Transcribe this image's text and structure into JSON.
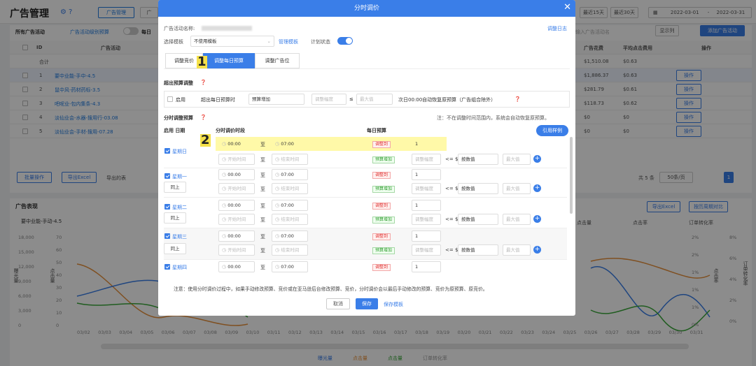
{
  "page": {
    "title": "广告管理",
    "top_tabs": [
      "广告管理",
      "广"
    ],
    "date_shortcuts": [
      "最近15天",
      "最近30天"
    ],
    "date_start": "2022-03-01",
    "date_end": "2022-03-31",
    "filter_label": "所有广告活动",
    "filter_link": "广告活动级别预算",
    "daily_label": "每日",
    "display_col_btn": "显示列",
    "add_campaign_btn": "添加广告活动",
    "search_placeholder": "输入广告活动名",
    "col_id": "ID",
    "col_campaign": "广告活动",
    "col_spend": "广告花费",
    "col_cpc": "平均点击费用",
    "col_action": "操作",
    "total_label": "合计",
    "total_spend": "$1,510.08",
    "total_cpc": "$0.63",
    "rows": [
      {
        "id": "1",
        "name": "要中业能-手中-4.5",
        "spend": "$1,886.37",
        "cpc": "$0.63"
      },
      {
        "id": "2",
        "name": "鼠中风-药材药标-3.5",
        "spend": "$281.79",
        "cpc": "$0.61"
      },
      {
        "id": "3",
        "name": "吧呢业-包内集条-4.3",
        "spend": "$118.73",
        "cpc": "$0.62"
      },
      {
        "id": "4",
        "name": "淡仙业会-水器-搜用行-03.08",
        "spend": "$0",
        "cpc": "$0"
      },
      {
        "id": "5",
        "name": "淡仙业会-手材-搜用-07.28",
        "spend": "$0",
        "cpc": "$0"
      }
    ],
    "action_label": "操作",
    "bulk_btn": "批量操作",
    "export_btn": "导出Excel",
    "export_btn2": "导出的表",
    "pager_total": "共 5 条",
    "pager_size": "50条/页",
    "pager_current": "1",
    "chart_title": "广告表现",
    "chart_subtitle": "要中业能-手动-4.5",
    "chart_export": "导出Excel",
    "chart_compare": "按历周期对比",
    "y_left_label1": "曝光量",
    "y_left_label2": "点击量",
    "y_right_label1": "点击率",
    "y_right_label2": "订单转化率",
    "y_left_ticks": [
      "18,000",
      "15,000",
      "12,000",
      "9,000",
      "6,000",
      "3,000",
      "0"
    ],
    "y_left2_ticks": [
      "70",
      "60",
      "50",
      "40",
      "30",
      "20",
      "10",
      "0"
    ],
    "y_right_ticks": [
      "2%",
      "2%",
      "1%",
      "1%",
      "1%",
      "0%"
    ],
    "y_right2_ticks": [
      "8%",
      "6%",
      "4%",
      "2%",
      "0%"
    ],
    "x_ticks": [
      "03/02",
      "03/03",
      "03/04",
      "03/05",
      "03/06",
      "03/07",
      "03/08",
      "03/09",
      "03/10",
      "03/11",
      "03/12",
      "03/13",
      "03/14",
      "03/15",
      "03/16",
      "03/17",
      "03/18",
      "03/19",
      "03/20",
      "03/21",
      "03/22",
      "03/23",
      "03/24",
      "03/25",
      "03/26",
      "03/27",
      "03/28",
      "03/29",
      "03/30",
      "03/31"
    ],
    "legend": [
      "曝光量",
      "点击量",
      "点击量",
      "订单转化率"
    ],
    "col_clicks": "点击量",
    "col_ctr": "点击率",
    "col_orders": "订单转化率"
  },
  "modal": {
    "title": "分时调价",
    "campaign_name_label": "广告活动名称:",
    "change_log_link": "调整日志",
    "template_label": "选择模板",
    "template_value": "不使用模板",
    "manage_template_link": "管理模板",
    "plan_status_label": "计划状态",
    "tabs": [
      "调整竞价",
      "调整每日预算",
      "调整广告位"
    ],
    "section1_title": "超出预算调整",
    "enable_label": "启用",
    "exceed_label": "超出每日预算时",
    "budget_increase": "预算增加",
    "adjust_amount_placeholder": "调整幅度",
    "lte_symbol": "≤",
    "max_value_placeholder": "最大值",
    "restore_text": "次日00:00自动恢复原预算（广告组合除外）",
    "section2_title": "分时调整预算",
    "note_top": "注：不在调整时间范围内，系统会自动恢复原预算。",
    "col_enable_date": "启用 日期",
    "col_time": "分时调价时段",
    "col_daily_budget": "每日预算",
    "quote_template_btn": "引用样例",
    "to_label": "至",
    "start_time": "00:00",
    "end_time": "07:00",
    "start_placeholder": "开始时间",
    "end_placeholder": "结束时间",
    "tag_adjust_to": "调整到",
    "tag_budget_increase": "预算增加",
    "value_one": "1",
    "adjust_placeholder": "调整幅度",
    "lte5": "<= $",
    "by_value": "按数值",
    "max_placeholder": "最大值",
    "same_as_above": "同上",
    "days": [
      "星期日",
      "星期一",
      "星期二",
      "星期三",
      "星期四"
    ],
    "note_bottom": "注意：使用分时调价过程中，如果手动修改预算、竞价或在亚马逊后台修改预算、竞价，分时调价会以最后手动修改的预算、竞价为原预算、原竞价。",
    "cancel_btn": "取消",
    "save_btn": "保存",
    "save_template_link": "保存模板"
  },
  "annotations": {
    "one": "1",
    "two": "2"
  },
  "colors": {
    "primary": "#3a7ee8",
    "highlight": "#fff9a8",
    "annotation_bg": "#f5e14a"
  }
}
